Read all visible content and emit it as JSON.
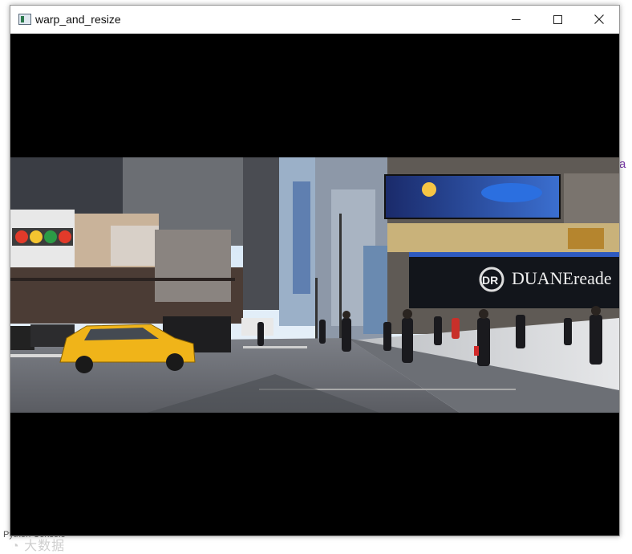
{
  "window": {
    "title": "warp_and_resize"
  },
  "controls": {
    "minimize": "minimize",
    "maximize": "maximize",
    "close": "close"
  },
  "image": {
    "billboard_text": "DUANEreade"
  },
  "background": {
    "console_text": "Python Console"
  }
}
